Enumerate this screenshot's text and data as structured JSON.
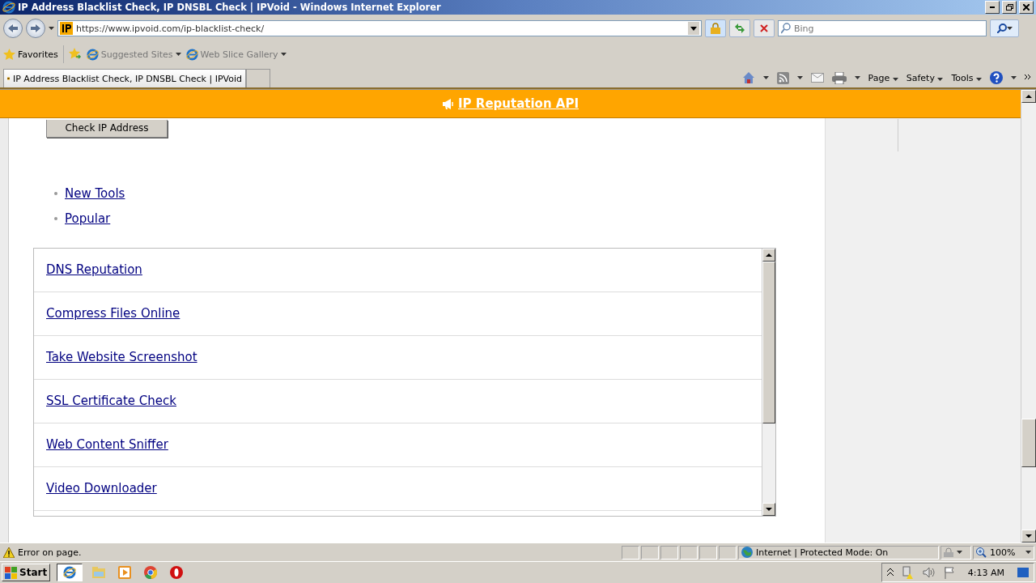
{
  "window": {
    "title": "IP Address Blacklist Check, IP DNSBL Check | IPVoid - Windows Internet Explorer"
  },
  "navigation": {
    "address": "https://www.ipvoid.com/ip-blacklist-check/",
    "search_placeholder": "Bing"
  },
  "favorites_bar": {
    "favorites": "Favorites",
    "links": [
      {
        "label": "Suggested Sites"
      },
      {
        "label": "Web Slice Gallery"
      }
    ]
  },
  "tabs": [
    {
      "label": "IP Address Blacklist Check, IP DNSBL Check | IPVoid",
      "selected": true
    }
  ],
  "command_bar": [
    "Page",
    "Safety",
    "Tools"
  ],
  "page": {
    "banner": "IP Reputation API",
    "check_button": "Check IP Address",
    "nav_links": [
      "New Tools",
      "Popular"
    ],
    "tools_list": [
      "DNS Reputation",
      "Compress Files Online",
      "Take Website Screenshot",
      "SSL Certificate Check",
      "Web Content Sniffer",
      "Video Downloader"
    ]
  },
  "status_bar": {
    "message": "Error on page.",
    "zone": "Internet | Protected Mode: On",
    "zoom": "100%"
  },
  "taskbar": {
    "start": "Start",
    "clock": "4:13 AM"
  }
}
